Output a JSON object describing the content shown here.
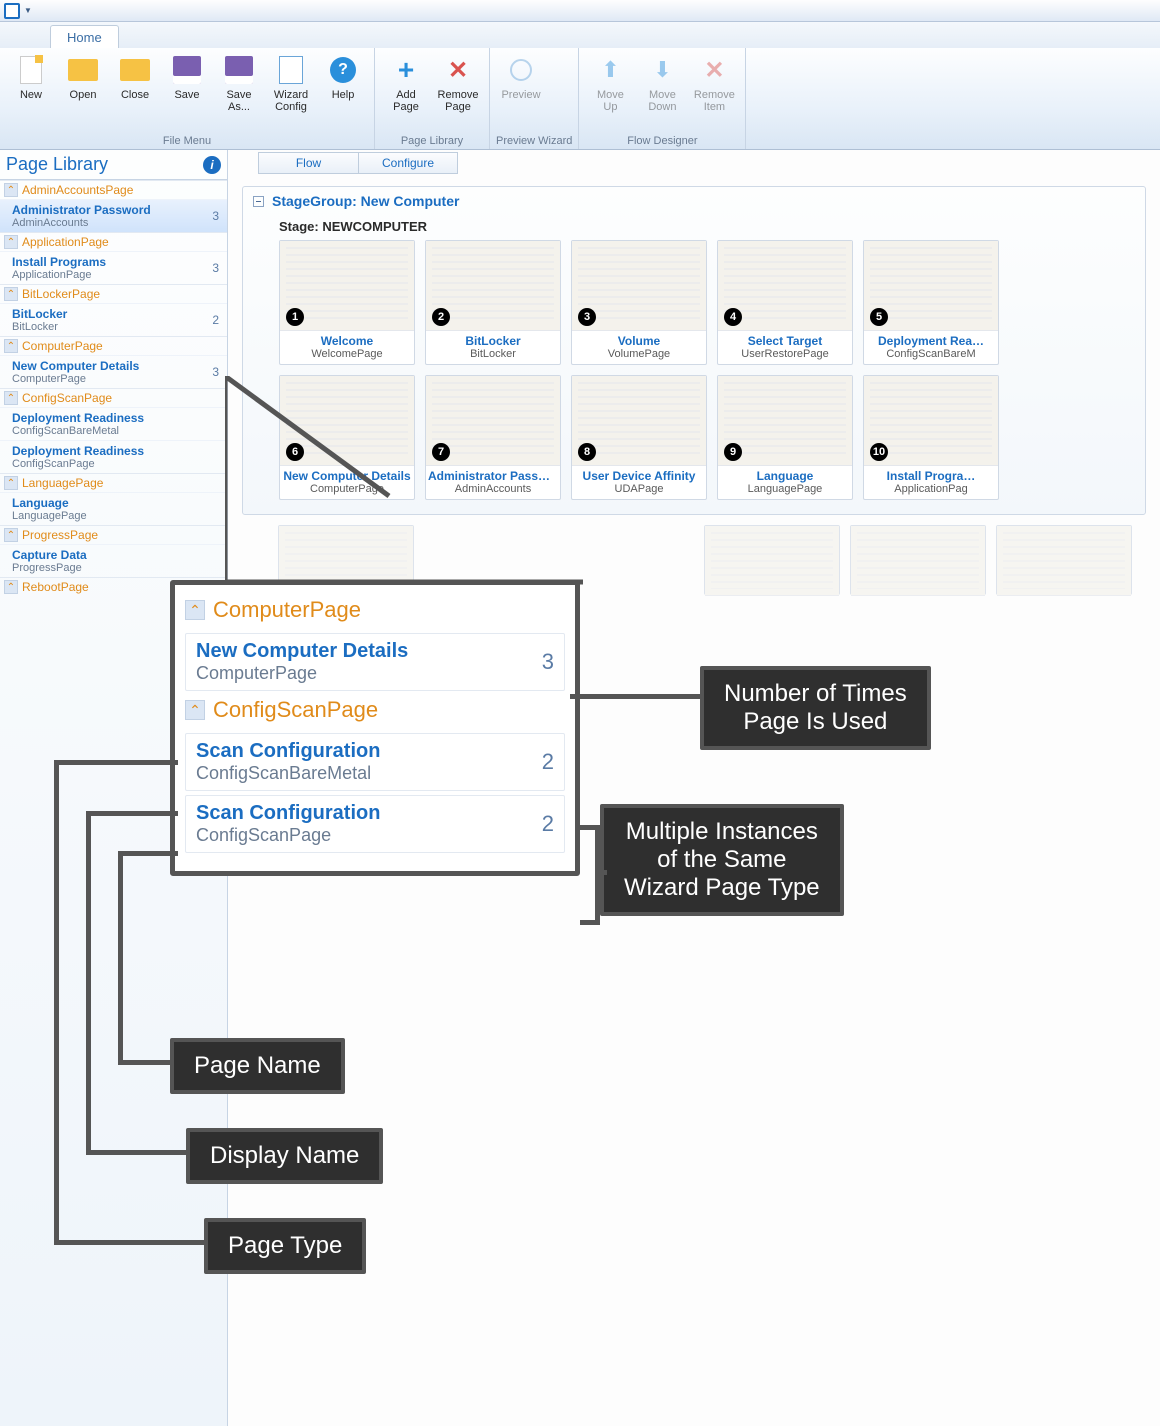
{
  "tab": "Home",
  "ribbon": {
    "groups": [
      {
        "label": "File Menu",
        "buttons": [
          {
            "name": "new",
            "label": "New",
            "icon": "📄"
          },
          {
            "name": "open",
            "label": "Open",
            "icon": "📂"
          },
          {
            "name": "close",
            "label": "Close",
            "icon": "📁"
          },
          {
            "name": "save",
            "label": "Save",
            "icon": "💾"
          },
          {
            "name": "saveas",
            "label": "Save\nAs...",
            "icon": "💾"
          },
          {
            "name": "wizcfg",
            "label": "Wizard\nConfig",
            "icon": "📋"
          },
          {
            "name": "help",
            "label": "Help",
            "icon": "?"
          }
        ]
      },
      {
        "label": "Page Library",
        "buttons": [
          {
            "name": "addpage",
            "label": "Add\nPage",
            "icon": "+"
          },
          {
            "name": "rempage",
            "label": "Remove\nPage",
            "icon": "✕"
          }
        ]
      },
      {
        "label": "Preview Wizard",
        "buttons": [
          {
            "name": "preview",
            "label": "Preview",
            "icon": "🔍",
            "dim": true
          }
        ]
      },
      {
        "label": "Flow Designer",
        "buttons": [
          {
            "name": "moveup",
            "label": "Move\nUp",
            "icon": "▲",
            "dim": true
          },
          {
            "name": "movedn",
            "label": "Move\nDown",
            "icon": "▼",
            "dim": true
          },
          {
            "name": "remitem",
            "label": "Remove\nItem",
            "icon": "✕",
            "dim": true
          }
        ]
      }
    ]
  },
  "sidebar": {
    "title": "Page Library",
    "groups": [
      {
        "name": "AdminAccountsPage",
        "items": [
          {
            "dn": "Administrator Password",
            "pn": "AdminAccounts",
            "ct": 3,
            "sel": true
          }
        ]
      },
      {
        "name": "ApplicationPage",
        "items": [
          {
            "dn": "Install Programs",
            "pn": "ApplicationPage",
            "ct": 3
          }
        ]
      },
      {
        "name": "BitLockerPage",
        "items": [
          {
            "dn": "BitLocker",
            "pn": "BitLocker",
            "ct": 2
          }
        ]
      },
      {
        "name": "ComputerPage",
        "items": [
          {
            "dn": "New Computer Details",
            "pn": "ComputerPage",
            "ct": 3
          }
        ]
      },
      {
        "name": "ConfigScanPage",
        "items": [
          {
            "dn": "Deployment Readiness",
            "pn": "ConfigScanBareMetal"
          },
          {
            "dn": "Deployment Readiness",
            "pn": "ConfigScanPage"
          }
        ]
      },
      {
        "name": "LanguagePage",
        "items": [
          {
            "dn": "Language",
            "pn": "LanguagePage"
          }
        ]
      },
      {
        "name": "ProgressPage",
        "items": [
          {
            "dn": "Capture Data",
            "pn": "ProgressPage"
          }
        ]
      },
      {
        "name": "RebootPage",
        "items": []
      }
    ]
  },
  "main": {
    "tabs": [
      "Flow",
      "Configure"
    ],
    "stagegroup": "StageGroup: New Computer",
    "stage": "Stage: NEWCOMPUTER",
    "thumbs": [
      {
        "n": 1,
        "dn": "Welcome",
        "pn": "WelcomePage"
      },
      {
        "n": 2,
        "dn": "BitLocker",
        "pn": "BitLocker"
      },
      {
        "n": 3,
        "dn": "Volume",
        "pn": "VolumePage"
      },
      {
        "n": 4,
        "dn": "Select Target",
        "pn": "UserRestorePage"
      },
      {
        "n": 5,
        "dn": "Deployment Rea…",
        "pn": "ConfigScanBareM"
      },
      {
        "n": 6,
        "dn": "New Computer Details",
        "pn": "ComputerPage"
      },
      {
        "n": 7,
        "dn": "Administrator Passw…",
        "pn": "AdminAccounts"
      },
      {
        "n": 8,
        "dn": "User Device Affinity",
        "pn": "UDAPage"
      },
      {
        "n": 9,
        "dn": "Language",
        "pn": "LanguagePage"
      },
      {
        "n": 10,
        "dn": "Install Progra…",
        "pn": "ApplicationPag"
      }
    ]
  },
  "zoom": {
    "g1": "ComputerPage",
    "i1": {
      "dn": "New Computer Details",
      "pn": "ComputerPage",
      "ct": 3
    },
    "g2": "ConfigScanPage",
    "i2": {
      "dn": "Scan Configuration",
      "pn": "ConfigScanBareMetal",
      "ct": 2
    },
    "i3": {
      "dn": "Scan Configuration",
      "pn": "ConfigScanPage",
      "ct": 2
    }
  },
  "anno": {
    "a1": "Number of Times\nPage Is Used",
    "a2": "Multiple Instances\nof the Same\nWizard Page Type",
    "a3": "Page Name",
    "a4": "Display Name",
    "a5": "Page Type"
  }
}
